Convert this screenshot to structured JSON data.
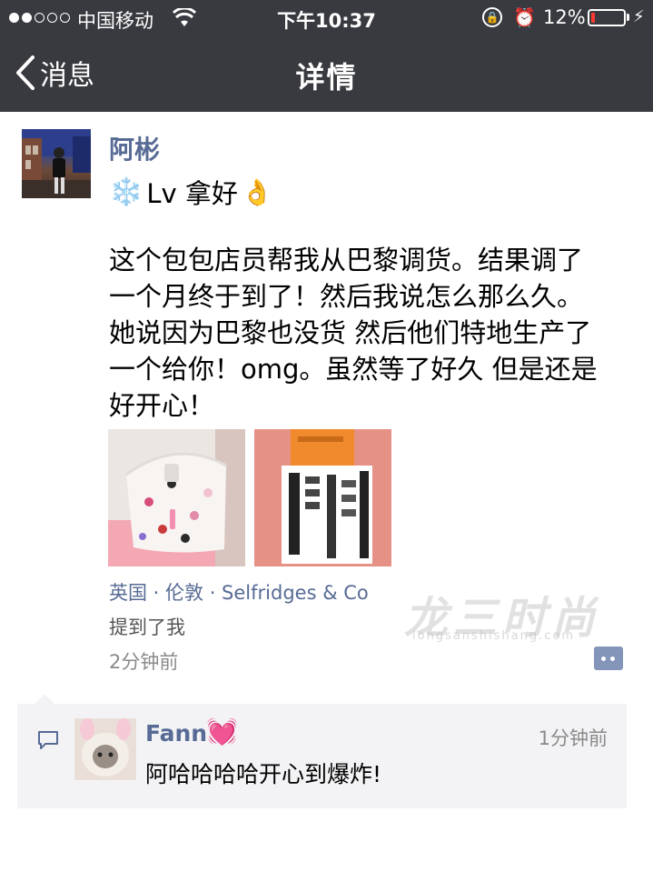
{
  "status_bar": {
    "carrier": "中国移动",
    "time": "下午10:37",
    "battery_percent": "12%",
    "battery_level": 0.12,
    "battery_color": "#ff3b30",
    "signal_filled": 2,
    "signal_total": 5,
    "icons": [
      "wifi-icon",
      "orientation-lock-icon",
      "alarm-icon",
      "battery-icon",
      "charging-bolt-icon"
    ]
  },
  "nav": {
    "back_label": "消息",
    "title": "详情"
  },
  "post": {
    "author": "阿彬",
    "first_line": "Lv 拿好",
    "emoji_prefix": "❄️",
    "emoji_suffix": "👌",
    "body": "这个包包店员帮我从巴黎调货。结果调了\n一个月终于到了！然后我说怎么那么久。\n她说因为巴黎也没货 然后他们特地生产了\n一个给你！omg。虽然等了好久 但是还是\n好开心！",
    "location": "英国 · 伦敦 · Selfridges & Co",
    "mention": "提到了我",
    "time_ago": "2分钟前"
  },
  "comments": [
    {
      "name": "Fann",
      "emoji": "💓",
      "time": "1分钟前",
      "text": "阿哈哈哈哈开心到爆炸!"
    }
  ],
  "colors": {
    "nav_background": "#393a3f",
    "link": "#576b95",
    "comment_background": "#f3f3f5"
  }
}
